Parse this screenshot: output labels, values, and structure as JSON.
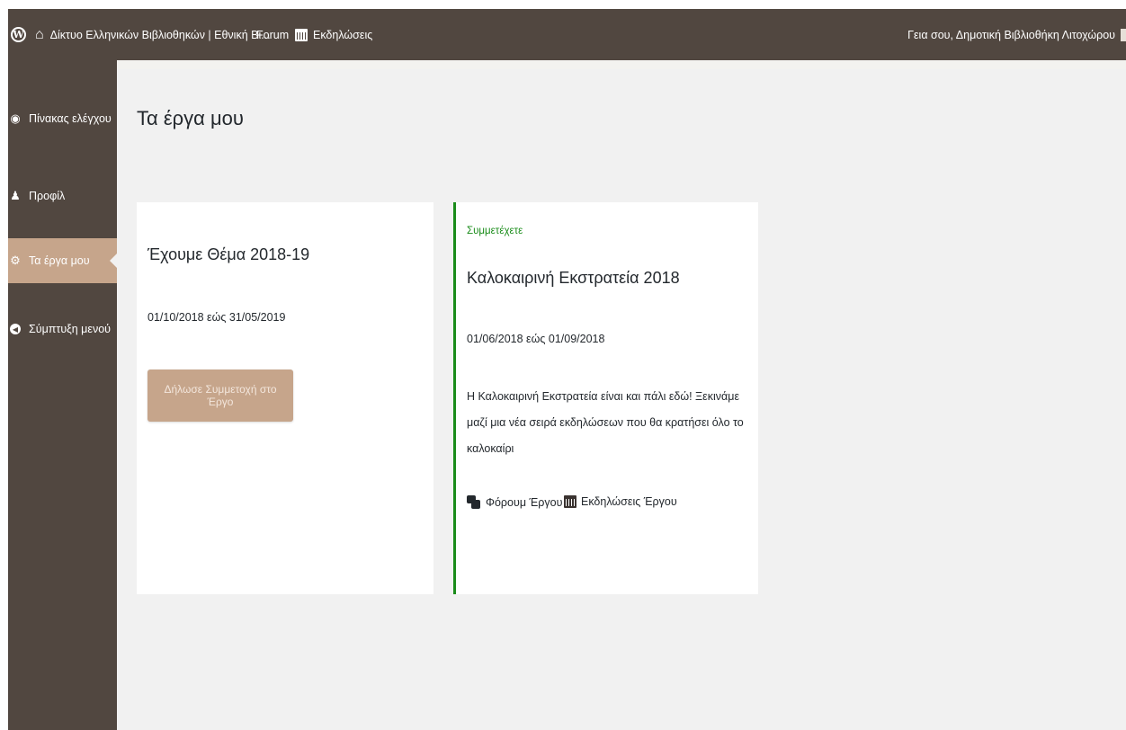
{
  "admin_bar": {
    "site_name": "Δίκτυο Ελληνικών Βιβλιοθηκών | Εθνική Βι...",
    "forum_label": "Forum",
    "events_label": "Εκδηλώσεις",
    "account_greeting": "Γεια σου, Δημοτική Βιβλιοθήκη Λιτοχώρου",
    "icons": [
      "wordpress-logo-icon",
      "home-icon",
      "calendar-icon"
    ]
  },
  "sidebar": {
    "items": [
      {
        "label": "Πίνακας ελέγχου",
        "icon": "dashboard-icon",
        "active": false
      },
      {
        "label": "Προφίλ",
        "icon": "user-icon",
        "active": false
      },
      {
        "label": "Τα έργα μου",
        "icon": "gear-icon",
        "active": true
      },
      {
        "label": "Σύμπτυξη μενού",
        "icon": "collapse-icon",
        "active": false
      }
    ]
  },
  "main": {
    "title": "Τα έργα μου",
    "projects": [
      {
        "title": "Έχουμε Θέμα 2018-19",
        "dates": "01/10/2018 εώς 31/05/2019",
        "button_label": "Δήλωσε Συμμετοχή στο Έργο"
      },
      {
        "status": "Συμμετέχετε",
        "title": "Καλοκαιρινή Εκστρατεία 2018",
        "dates": "01/06/2018 εώς 01/09/2018",
        "description": "Η Καλοκαιρινή Εκστρατεία είναι και πάλι εδώ! Ξεκινάμε μαζί μια νέα σειρά εκδηλώσεων που θα κρατήσει όλο το καλοκαίρι",
        "forum_link": "Φόρουμ Έργου",
        "events_link": "Εκδηλώσεις Έργου"
      }
    ]
  },
  "colors": {
    "admin_bar_bg": "#514740",
    "active_menu_bg": "#c6a58b",
    "main_bg": "#f1f1f1",
    "participating_green": "#1a8c1a"
  }
}
